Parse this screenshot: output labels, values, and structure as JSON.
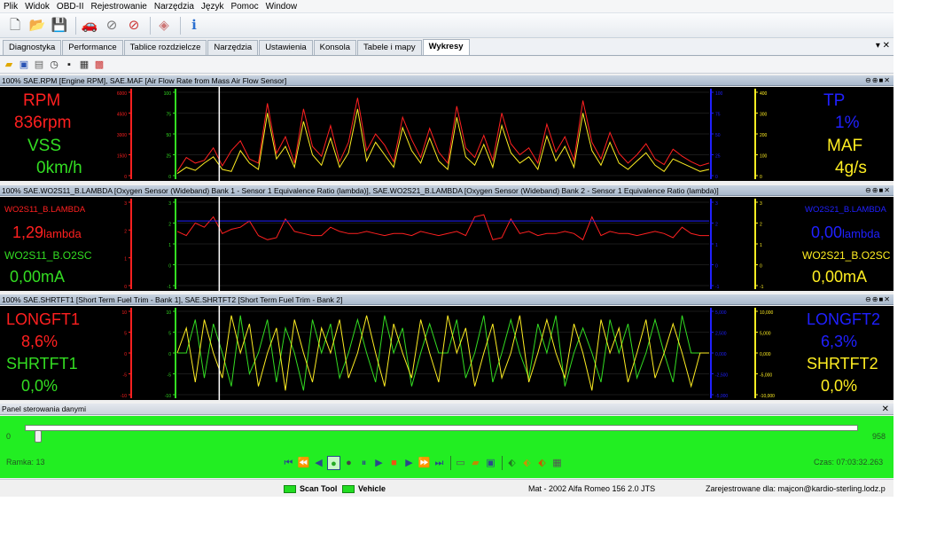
{
  "menu": [
    "Plik",
    "Widok",
    "OBD-II",
    "Rejestrowanie",
    "Narzędzia",
    "Język",
    "Pomoc",
    "Window"
  ],
  "toolbar_icons": [
    "new-file-icon",
    "open-folder-icon",
    "save-icon",
    "car-icon",
    "connect-icon",
    "disconnect-icon",
    "gauge-icon",
    "info-icon"
  ],
  "tabs": [
    {
      "label": "Diagnostyka",
      "active": false
    },
    {
      "label": "Performance",
      "active": false
    },
    {
      "label": "Tablice rozdzielcze",
      "active": false
    },
    {
      "label": "Narzędzia",
      "active": false
    },
    {
      "label": "Ustawienia",
      "active": false
    },
    {
      "label": "Konsola",
      "active": false
    },
    {
      "label": "Tabele i mapy",
      "active": false
    },
    {
      "label": "Wykresy",
      "active": true
    }
  ],
  "tab_controls": "▾ ✕",
  "panels": [
    {
      "header": "100% SAE.RPM [Engine RPM], SAE.MAF [Air Flow Rate from Mass Air Flow Sensor]",
      "left": [
        {
          "text": "RPM",
          "color": "#ff2020"
        },
        {
          "text": "836rpm",
          "color": "#ff2020"
        },
        {
          "text": "VSS",
          "color": "#33dd22"
        },
        {
          "text": "0km/h",
          "color": "#33dd22"
        }
      ],
      "right": [
        {
          "text": "TP",
          "color": "#2020ff"
        },
        {
          "text": "1%",
          "color": "#2020ff"
        },
        {
          "text": "MAF",
          "color": "#ffee22"
        },
        {
          "text": "4g/s",
          "color": "#ffee22"
        }
      ],
      "axes": {
        "red": [
          "6000",
          "4500",
          "3000",
          "1500",
          "0"
        ],
        "green": [
          "100",
          "75",
          "50",
          "25",
          "0"
        ],
        "blue": [
          "100",
          "75",
          "50",
          "25",
          "0"
        ],
        "yellow": [
          "400",
          "300",
          "200",
          "100",
          "0"
        ]
      }
    },
    {
      "header": "100% SAE.WO2S11_B.LAMBDA [Oxygen Sensor (Wideband) Bank 1 - Sensor 1 Equivalence Ratio (lambda)], SAE.WO2S21_B.LAMBDA [Oxygen Sensor (Wideband) Bank 2 - Sensor 1 Equivalence Ratio (lambda)]",
      "left": [
        {
          "text": "WO2S11_B.LAMBDA",
          "color": "#ff2020"
        },
        {
          "text": "1,29",
          "unit": "lambda",
          "color": "#ff2020"
        },
        {
          "text": "WO2S11_B.O2SC",
          "color": "#33dd22"
        },
        {
          "text": "0,00mA",
          "color": "#33dd22"
        }
      ],
      "right": [
        {
          "text": "WO2S21_B.LAMBDA",
          "color": "#2020ff"
        },
        {
          "text": "0,00",
          "unit": "lambda",
          "color": "#2020ff"
        },
        {
          "text": "WO2S21_B.O2SC",
          "color": "#ffee22"
        },
        {
          "text": "0,00mA",
          "color": "#ffee22"
        }
      ],
      "axes": {
        "red": [
          "3",
          "2",
          "1",
          "0"
        ],
        "green": [
          "3",
          "2",
          "1",
          "0",
          "-1"
        ],
        "blue": [
          "3",
          "2",
          "1",
          "0",
          "-1"
        ],
        "yellow": [
          "3",
          "2",
          "1",
          "0",
          "-1"
        ]
      }
    },
    {
      "header": "100% SAE.SHRTFT1 [Short Term Fuel Trim - Bank 1], SAE.SHRTFT2 [Short Term Fuel Trim - Bank 2]",
      "left": [
        {
          "text": "LONGFT1",
          "color": "#ff2020"
        },
        {
          "text": "8,6%",
          "color": "#ff2020"
        },
        {
          "text": "SHRTFT1",
          "color": "#33dd22"
        },
        {
          "text": "0,0%",
          "color": "#33dd22"
        }
      ],
      "right": [
        {
          "text": "LONGFT2",
          "color": "#2020ff"
        },
        {
          "text": "6,3%",
          "color": "#2020ff"
        },
        {
          "text": "SHRTFT2",
          "color": "#ffee22"
        },
        {
          "text": "0,0%",
          "color": "#ffee22"
        }
      ],
      "axes": {
        "red": [
          "10",
          "5",
          "0",
          "-5",
          "-10"
        ],
        "green": [
          "10",
          "5",
          "0",
          "-5",
          "-10"
        ],
        "blue": [
          "5,000",
          "2,500",
          "0,000",
          "-2,500",
          "-5,000"
        ],
        "yellow": [
          "10,000",
          "5,000",
          "0,000",
          "-5,000",
          "-10,000"
        ]
      }
    }
  ],
  "header_controls": "⊖⊕■✕",
  "control_panel": {
    "title": "Panel sterowania danymi",
    "slider_min": "0",
    "slider_max": "958",
    "frame_label": "Ramka:",
    "frame_value": "13",
    "time_label": "Czas:",
    "time_value": "07:03:32.263",
    "frame_fraction": 0.0136
  },
  "statusbar": {
    "scan_tool": "Scan Tool",
    "vehicle": "Vehicle",
    "vehicle_info": "Mat - 2002 Alfa Romeo 156 2.0 JTS",
    "registered": "Zarejestrowane dla: majcon@kardio-sterling.lodz.p"
  },
  "chart_data": [
    {
      "type": "line",
      "series": [
        {
          "name": "RPM",
          "color": "#ff2020",
          "values": [
            300,
            1300,
            900,
            1100,
            2000,
            700,
            1800,
            2500,
            1200,
            900,
            5200,
            1600,
            2800,
            900,
            4800,
            2100,
            1400,
            3600,
            1000,
            2400,
            5600,
            1800,
            3000,
            2200,
            1000,
            4200,
            2600,
            1300,
            3400,
            1700,
            900,
            5000,
            2000,
            1300,
            2900,
            1100,
            4500,
            2300,
            1500,
            2000,
            900,
            3700,
            1700,
            2800,
            1100,
            5400,
            2400,
            1200,
            3100,
            1600,
            900,
            1500,
            2300,
            1200,
            800,
            1900,
            1400,
            1000,
            700,
            900
          ],
          "ylim": [
            0,
            6000
          ]
        },
        {
          "name": "MAF",
          "color": "#ffee22",
          "values": [
            10,
            40,
            25,
            60,
            90,
            30,
            20,
            120,
            60,
            30,
            300,
            80,
            140,
            40,
            260,
            100,
            50,
            180,
            40,
            110,
            320,
            70,
            160,
            100,
            40,
            230,
            120,
            60,
            180,
            70,
            30,
            280,
            90,
            50,
            150,
            40,
            240,
            110,
            60,
            90,
            30,
            190,
            70,
            140,
            40,
            300,
            120,
            50,
            160,
            60,
            30,
            70,
            110,
            50,
            20,
            80,
            60,
            40,
            20,
            30
          ],
          "ylim": [
            0,
            400
          ]
        }
      ]
    },
    {
      "type": "line",
      "series": [
        {
          "name": "WO2S11_B.LAMBDA",
          "color": "#ff2020",
          "values": [
            1.6,
            1.4,
            2.0,
            1.8,
            2.3,
            1.5,
            1.7,
            1.8,
            2.1,
            1.4,
            1.2,
            1.3,
            2.2,
            1.6,
            1.5,
            1.4,
            1.4,
            1.8,
            1.6,
            1.5,
            1.5,
            1.6,
            1.5,
            1.4,
            1.5,
            1.5,
            1.4,
            1.6,
            1.5,
            1.4,
            1.5,
            1.6,
            1.4,
            2.3,
            2.4,
            1.2,
            1.3,
            2.2,
            1.5,
            1.6,
            1.4,
            1.5,
            1.5,
            1.6,
            1.5,
            1.2,
            2.3,
            1.4,
            1.6,
            1.5,
            1.5,
            1.4,
            1.5,
            1.6,
            1.5,
            1.3,
            1.8,
            1.5,
            1.4,
            1.4
          ],
          "ylim": [
            -1,
            3
          ]
        },
        {
          "name": "WO2S21_B.LAMBDA",
          "color": "#2020ff",
          "values": [
            2.1,
            2.1,
            2.1,
            2.1,
            2.1,
            2.1,
            2.1,
            2.1,
            2.1,
            2.1,
            2.1,
            2.1,
            2.1,
            2.1,
            2.1,
            2.1,
            2.1,
            2.1,
            2.1,
            2.1,
            2.1,
            2.1,
            2.1,
            2.1,
            2.1,
            2.1,
            2.1,
            2.1,
            2.1,
            2.1,
            2.1,
            2.1,
            2.1,
            2.1,
            2.1,
            2.1,
            2.1,
            2.1,
            2.1,
            2.1,
            2.1,
            2.1,
            2.1,
            2.1,
            2.1,
            2.1,
            2.1,
            2.1,
            2.1,
            2.1,
            2.1,
            2.1,
            2.1,
            2.1,
            2.1,
            2.1,
            2.1,
            2.1,
            2.1,
            2.1
          ],
          "ylim": [
            -1,
            3
          ]
        }
      ]
    },
    {
      "type": "line",
      "series": [
        {
          "name": "SHRTFT1",
          "color": "#33dd22",
          "values": [
            0,
            0,
            8,
            -6,
            7,
            0,
            -8,
            9,
            -5,
            0,
            8,
            -7,
            6,
            0,
            -9,
            8,
            0,
            7,
            -6,
            0,
            8,
            0,
            -7,
            9,
            0,
            6,
            -8,
            0,
            7,
            0,
            0,
            8,
            -6,
            0,
            9,
            -7,
            0,
            8,
            0,
            -6,
            7,
            0,
            9,
            -8,
            0,
            6,
            0,
            -7,
            8,
            0,
            7,
            -6,
            0,
            8,
            0,
            -7,
            9,
            0,
            0,
            0
          ],
          "ylim": [
            -10,
            10
          ]
        },
        {
          "name": "SHRTFT2",
          "color": "#ffee22",
          "values": [
            0,
            6,
            -7,
            8,
            0,
            -6,
            9,
            0,
            7,
            -8,
            0,
            6,
            -9,
            8,
            0,
            -7,
            6,
            0,
            8,
            -6,
            0,
            9,
            0,
            -8,
            7,
            0,
            -6,
            8,
            0,
            -7,
            9,
            0,
            6,
            -8,
            0,
            7,
            -6,
            0,
            9,
            -7,
            0,
            8,
            0,
            -6,
            7,
            0,
            -9,
            8,
            0,
            6,
            -7,
            0,
            8,
            -6,
            0,
            7,
            0,
            -8,
            0,
            0
          ],
          "ylim": [
            -10,
            10
          ]
        }
      ]
    }
  ]
}
